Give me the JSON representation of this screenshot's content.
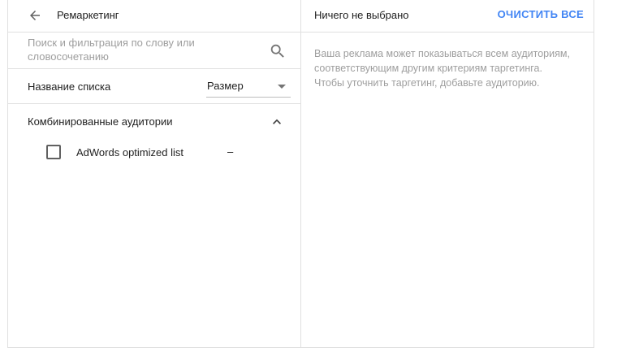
{
  "left_panel": {
    "title": "Ремаркетинг",
    "search": {
      "value": "",
      "placeholder": "Поиск и фильтрация по слову или словосочетанию"
    },
    "columns": {
      "name_label": "Название списка",
      "size_select": {
        "selected": "Размер"
      }
    },
    "group": {
      "label": "Комбинированные аудитории",
      "expanded": true,
      "items": [
        {
          "label": "AdWords optimized list",
          "size": "–",
          "checked": false
        }
      ]
    }
  },
  "right_panel": {
    "title": "Ничего не выбрано",
    "clear_button": "ОЧИСТИТЬ ВСЕ",
    "info": "Ваша реклама может показываться всем аудиториям, соответствующим другим критериям таргетинга. Чтобы уточнить таргетинг, добавьте аудиторию."
  },
  "colors": {
    "accent": "#4285f4",
    "border": "#e0e0e0",
    "muted_text": "#9e9e9e",
    "text": "#212121"
  },
  "icons": {
    "back": "arrow-back-icon",
    "search": "search-icon",
    "collapse": "chevron-up-icon",
    "dropdown": "dropdown-arrow-icon"
  }
}
